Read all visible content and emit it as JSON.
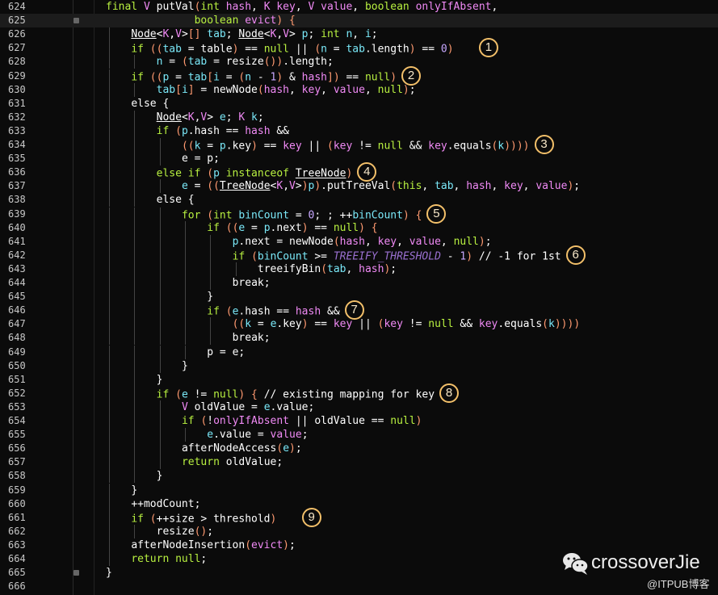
{
  "editor": {
    "current_line": 625,
    "lines": [
      {
        "n": "624",
        "indent": 0,
        "code": "final V putVal(int hash, K key, V value, boolean onlyIfAbsent,"
      },
      {
        "n": "625",
        "indent": 0,
        "pad": 14,
        "code": "boolean evict) {"
      },
      {
        "n": "626",
        "indent": 1,
        "code": "Node<K,V>[] tab; Node<K,V> p; int n, i;"
      },
      {
        "n": "627",
        "indent": 1,
        "code": "if ((tab = table) == null || (n = tab.length) == 0)",
        "mark": "1",
        "gap": 4
      },
      {
        "n": "628",
        "indent": 2,
        "code": "n = (tab = resize()).length;"
      },
      {
        "n": "629",
        "indent": 1,
        "code": "if ((p = tab[i = (n - 1) & hash]) == null)",
        "mark": "2"
      },
      {
        "n": "630",
        "indent": 2,
        "code": "tab[i] = newNode(hash, key, value, null);"
      },
      {
        "n": "631",
        "indent": 1,
        "code": "else {"
      },
      {
        "n": "632",
        "indent": 2,
        "code": "Node<K,V> e; K k;"
      },
      {
        "n": "633",
        "indent": 2,
        "code": "if (p.hash == hash &&"
      },
      {
        "n": "634",
        "indent": 3,
        "code": "((k = p.key) == key || (key != null && key.equals(k))))",
        "mark": "3"
      },
      {
        "n": "635",
        "indent": 3,
        "code": "e = p;"
      },
      {
        "n": "636",
        "indent": 2,
        "code": "else if (p instanceof TreeNode)",
        "mark": "4"
      },
      {
        "n": "637",
        "indent": 3,
        "code": "e = ((TreeNode<K,V>)p).putTreeVal(this, tab, hash, key, value);"
      },
      {
        "n": "638",
        "indent": 2,
        "code": "else {"
      },
      {
        "n": "639",
        "indent": 3,
        "code": "for (int binCount = 0; ; ++binCount) {",
        "mark": "5"
      },
      {
        "n": "640",
        "indent": 4,
        "code": "if ((e = p.next) == null) {"
      },
      {
        "n": "641",
        "indent": 5,
        "code": "p.next = newNode(hash, key, value, null);"
      },
      {
        "n": "642",
        "indent": 5,
        "code": "if (binCount >= TREEIFY_THRESHOLD - 1) // -1 for 1st",
        "mark": "6"
      },
      {
        "n": "643",
        "indent": 6,
        "code": "treeifyBin(tab, hash);"
      },
      {
        "n": "644",
        "indent": 5,
        "code": "break;"
      },
      {
        "n": "645",
        "indent": 4,
        "code": "}"
      },
      {
        "n": "646",
        "indent": 4,
        "code": "if (e.hash == hash &&",
        "mark": "7"
      },
      {
        "n": "647",
        "indent": 5,
        "code": "((k = e.key) == key || (key != null && key.equals(k))))"
      },
      {
        "n": "648",
        "indent": 5,
        "code": "break;"
      },
      {
        "n": "649",
        "indent": 4,
        "code": "p = e;"
      },
      {
        "n": "650",
        "indent": 3,
        "code": "}"
      },
      {
        "n": "651",
        "indent": 2,
        "code": "}"
      },
      {
        "n": "652",
        "indent": 2,
        "code": "if (e != null) { // existing mapping for key",
        "mark": "8"
      },
      {
        "n": "653",
        "indent": 3,
        "code": "V oldValue = e.value;"
      },
      {
        "n": "654",
        "indent": 3,
        "code": "if (!onlyIfAbsent || oldValue == null)"
      },
      {
        "n": "655",
        "indent": 4,
        "code": "e.value = value;"
      },
      {
        "n": "656",
        "indent": 3,
        "code": "afterNodeAccess(e);"
      },
      {
        "n": "657",
        "indent": 3,
        "code": "return oldValue;"
      },
      {
        "n": "658",
        "indent": 2,
        "code": "}"
      },
      {
        "n": "659",
        "indent": 1,
        "code": "}"
      },
      {
        "n": "660",
        "indent": 1,
        "code": "++modCount;"
      },
      {
        "n": "661",
        "indent": 1,
        "code": "if (++size > threshold)",
        "mark": "9",
        "gap": 4
      },
      {
        "n": "662",
        "indent": 2,
        "code": "resize();"
      },
      {
        "n": "663",
        "indent": 1,
        "code": "afterNodeInsertion(evict);"
      },
      {
        "n": "664",
        "indent": 1,
        "code": "return null;"
      },
      {
        "n": "665",
        "indent": 0,
        "code": "}"
      },
      {
        "n": "666",
        "indent": 0,
        "code": ""
      }
    ]
  },
  "watermark": {
    "name": "crossoverJie",
    "sub": "@ITPUB博客",
    "icon": "wechat-icon"
  },
  "colors": {
    "background": "#0b0b0b",
    "keyword": "#a6e22e",
    "param": "#d66ce0",
    "local": "#5fd6e8",
    "paren": "#f07a4e",
    "marker": "#f3c06a"
  }
}
